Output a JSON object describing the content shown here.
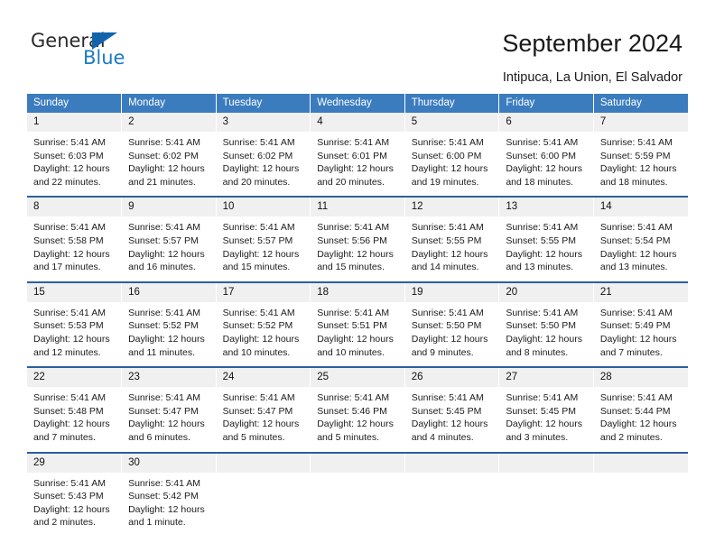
{
  "brand": {
    "name_top": "General",
    "name_bottom": "Blue",
    "triangle_color": "#1264aa",
    "blue_color": "#1b7bc4"
  },
  "header": {
    "title": "September 2024",
    "subtitle": "Intipuca, La Union, El Salvador"
  },
  "theme": {
    "header_blue": "#3b7cbf",
    "row_rule_blue": "#2c5f9e",
    "daynum_band": "#f0f0f0"
  },
  "weekdays": [
    "Sunday",
    "Monday",
    "Tuesday",
    "Wednesday",
    "Thursday",
    "Friday",
    "Saturday"
  ],
  "labels": {
    "sunrise_prefix": "Sunrise:",
    "sunset_prefix": "Sunset:",
    "daylight_prefix": "Daylight:"
  },
  "weeks": [
    [
      {
        "day": "1",
        "sunrise": "Sunrise: 5:41 AM",
        "sunset": "Sunset: 6:03 PM",
        "daylight_line1": "Daylight: 12 hours",
        "daylight_line2": "and 22 minutes."
      },
      {
        "day": "2",
        "sunrise": "Sunrise: 5:41 AM",
        "sunset": "Sunset: 6:02 PM",
        "daylight_line1": "Daylight: 12 hours",
        "daylight_line2": "and 21 minutes."
      },
      {
        "day": "3",
        "sunrise": "Sunrise: 5:41 AM",
        "sunset": "Sunset: 6:02 PM",
        "daylight_line1": "Daylight: 12 hours",
        "daylight_line2": "and 20 minutes."
      },
      {
        "day": "4",
        "sunrise": "Sunrise: 5:41 AM",
        "sunset": "Sunset: 6:01 PM",
        "daylight_line1": "Daylight: 12 hours",
        "daylight_line2": "and 20 minutes."
      },
      {
        "day": "5",
        "sunrise": "Sunrise: 5:41 AM",
        "sunset": "Sunset: 6:00 PM",
        "daylight_line1": "Daylight: 12 hours",
        "daylight_line2": "and 19 minutes."
      },
      {
        "day": "6",
        "sunrise": "Sunrise: 5:41 AM",
        "sunset": "Sunset: 6:00 PM",
        "daylight_line1": "Daylight: 12 hours",
        "daylight_line2": "and 18 minutes."
      },
      {
        "day": "7",
        "sunrise": "Sunrise: 5:41 AM",
        "sunset": "Sunset: 5:59 PM",
        "daylight_line1": "Daylight: 12 hours",
        "daylight_line2": "and 18 minutes."
      }
    ],
    [
      {
        "day": "8",
        "sunrise": "Sunrise: 5:41 AM",
        "sunset": "Sunset: 5:58 PM",
        "daylight_line1": "Daylight: 12 hours",
        "daylight_line2": "and 17 minutes."
      },
      {
        "day": "9",
        "sunrise": "Sunrise: 5:41 AM",
        "sunset": "Sunset: 5:57 PM",
        "daylight_line1": "Daylight: 12 hours",
        "daylight_line2": "and 16 minutes."
      },
      {
        "day": "10",
        "sunrise": "Sunrise: 5:41 AM",
        "sunset": "Sunset: 5:57 PM",
        "daylight_line1": "Daylight: 12 hours",
        "daylight_line2": "and 15 minutes."
      },
      {
        "day": "11",
        "sunrise": "Sunrise: 5:41 AM",
        "sunset": "Sunset: 5:56 PM",
        "daylight_line1": "Daylight: 12 hours",
        "daylight_line2": "and 15 minutes."
      },
      {
        "day": "12",
        "sunrise": "Sunrise: 5:41 AM",
        "sunset": "Sunset: 5:55 PM",
        "daylight_line1": "Daylight: 12 hours",
        "daylight_line2": "and 14 minutes."
      },
      {
        "day": "13",
        "sunrise": "Sunrise: 5:41 AM",
        "sunset": "Sunset: 5:55 PM",
        "daylight_line1": "Daylight: 12 hours",
        "daylight_line2": "and 13 minutes."
      },
      {
        "day": "14",
        "sunrise": "Sunrise: 5:41 AM",
        "sunset": "Sunset: 5:54 PM",
        "daylight_line1": "Daylight: 12 hours",
        "daylight_line2": "and 13 minutes."
      }
    ],
    [
      {
        "day": "15",
        "sunrise": "Sunrise: 5:41 AM",
        "sunset": "Sunset: 5:53 PM",
        "daylight_line1": "Daylight: 12 hours",
        "daylight_line2": "and 12 minutes."
      },
      {
        "day": "16",
        "sunrise": "Sunrise: 5:41 AM",
        "sunset": "Sunset: 5:52 PM",
        "daylight_line1": "Daylight: 12 hours",
        "daylight_line2": "and 11 minutes."
      },
      {
        "day": "17",
        "sunrise": "Sunrise: 5:41 AM",
        "sunset": "Sunset: 5:52 PM",
        "daylight_line1": "Daylight: 12 hours",
        "daylight_line2": "and 10 minutes."
      },
      {
        "day": "18",
        "sunrise": "Sunrise: 5:41 AM",
        "sunset": "Sunset: 5:51 PM",
        "daylight_line1": "Daylight: 12 hours",
        "daylight_line2": "and 10 minutes."
      },
      {
        "day": "19",
        "sunrise": "Sunrise: 5:41 AM",
        "sunset": "Sunset: 5:50 PM",
        "daylight_line1": "Daylight: 12 hours",
        "daylight_line2": "and 9 minutes."
      },
      {
        "day": "20",
        "sunrise": "Sunrise: 5:41 AM",
        "sunset": "Sunset: 5:50 PM",
        "daylight_line1": "Daylight: 12 hours",
        "daylight_line2": "and 8 minutes."
      },
      {
        "day": "21",
        "sunrise": "Sunrise: 5:41 AM",
        "sunset": "Sunset: 5:49 PM",
        "daylight_line1": "Daylight: 12 hours",
        "daylight_line2": "and 7 minutes."
      }
    ],
    [
      {
        "day": "22",
        "sunrise": "Sunrise: 5:41 AM",
        "sunset": "Sunset: 5:48 PM",
        "daylight_line1": "Daylight: 12 hours",
        "daylight_line2": "and 7 minutes."
      },
      {
        "day": "23",
        "sunrise": "Sunrise: 5:41 AM",
        "sunset": "Sunset: 5:47 PM",
        "daylight_line1": "Daylight: 12 hours",
        "daylight_line2": "and 6 minutes."
      },
      {
        "day": "24",
        "sunrise": "Sunrise: 5:41 AM",
        "sunset": "Sunset: 5:47 PM",
        "daylight_line1": "Daylight: 12 hours",
        "daylight_line2": "and 5 minutes."
      },
      {
        "day": "25",
        "sunrise": "Sunrise: 5:41 AM",
        "sunset": "Sunset: 5:46 PM",
        "daylight_line1": "Daylight: 12 hours",
        "daylight_line2": "and 5 minutes."
      },
      {
        "day": "26",
        "sunrise": "Sunrise: 5:41 AM",
        "sunset": "Sunset: 5:45 PM",
        "daylight_line1": "Daylight: 12 hours",
        "daylight_line2": "and 4 minutes."
      },
      {
        "day": "27",
        "sunrise": "Sunrise: 5:41 AM",
        "sunset": "Sunset: 5:45 PM",
        "daylight_line1": "Daylight: 12 hours",
        "daylight_line2": "and 3 minutes."
      },
      {
        "day": "28",
        "sunrise": "Sunrise: 5:41 AM",
        "sunset": "Sunset: 5:44 PM",
        "daylight_line1": "Daylight: 12 hours",
        "daylight_line2": "and 2 minutes."
      }
    ],
    [
      {
        "day": "29",
        "sunrise": "Sunrise: 5:41 AM",
        "sunset": "Sunset: 5:43 PM",
        "daylight_line1": "Daylight: 12 hours",
        "daylight_line2": "and 2 minutes."
      },
      {
        "day": "30",
        "sunrise": "Sunrise: 5:41 AM",
        "sunset": "Sunset: 5:42 PM",
        "daylight_line1": "Daylight: 12 hours",
        "daylight_line2": "and 1 minute."
      },
      {
        "day": "",
        "sunrise": "",
        "sunset": "",
        "daylight_line1": "",
        "daylight_line2": ""
      },
      {
        "day": "",
        "sunrise": "",
        "sunset": "",
        "daylight_line1": "",
        "daylight_line2": ""
      },
      {
        "day": "",
        "sunrise": "",
        "sunset": "",
        "daylight_line1": "",
        "daylight_line2": ""
      },
      {
        "day": "",
        "sunrise": "",
        "sunset": "",
        "daylight_line1": "",
        "daylight_line2": ""
      },
      {
        "day": "",
        "sunrise": "",
        "sunset": "",
        "daylight_line1": "",
        "daylight_line2": ""
      }
    ]
  ]
}
